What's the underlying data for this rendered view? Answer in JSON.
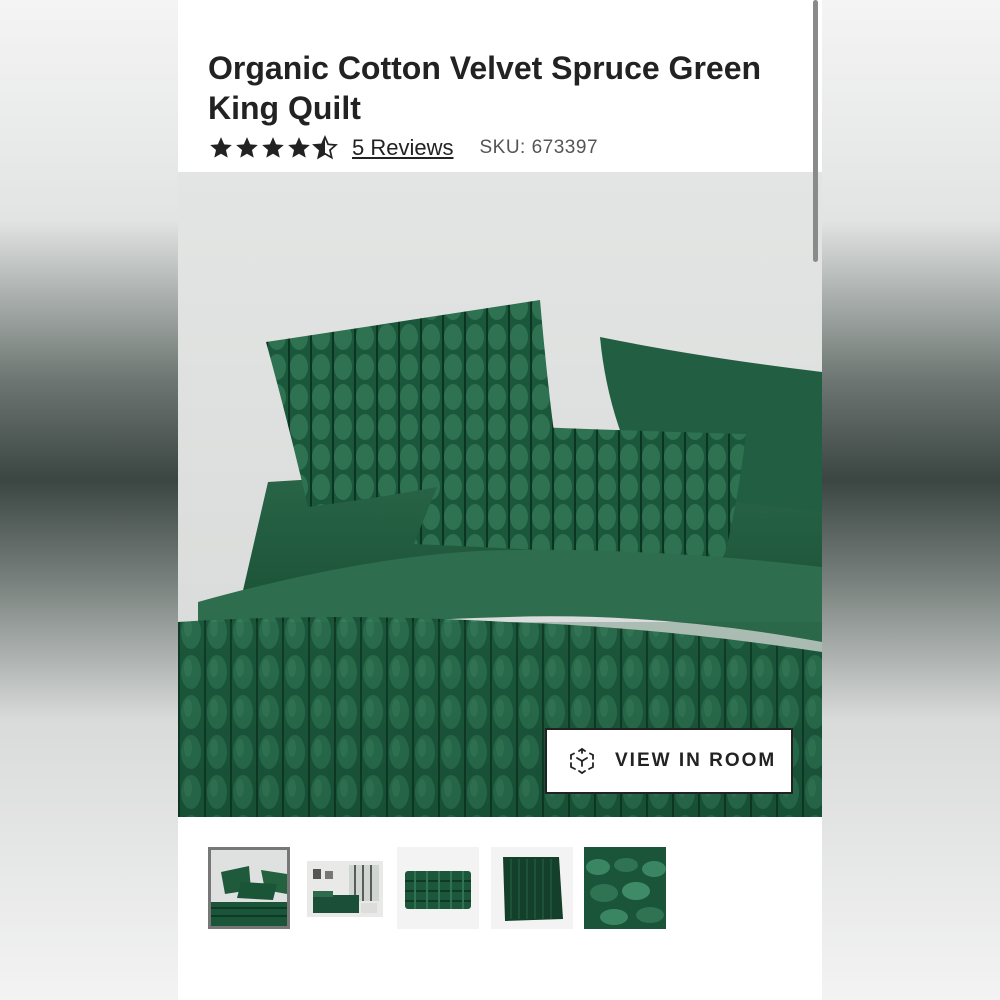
{
  "product": {
    "title": "Organic Cotton Velvet Spruce Green King Quilt",
    "rating": 4.5,
    "rating_max": 5,
    "reviews_label": "5 Reviews",
    "sku_label": "SKU: 673397"
  },
  "hero": {
    "view_in_room_label": "VIEW IN ROOM",
    "view_in_room_icon": "ar-cube-icon"
  },
  "thumbnails": [
    {
      "name": "thumbnail-bed-closeup",
      "selected": true
    },
    {
      "name": "thumbnail-bedroom-scene",
      "selected": false
    },
    {
      "name": "thumbnail-folded-quilt",
      "selected": false
    },
    {
      "name": "thumbnail-flat-quilt",
      "selected": false
    },
    {
      "name": "thumbnail-velvet-texture",
      "selected": false
    }
  ],
  "colors": {
    "spruce_green": "#1f5a3d",
    "text": "#222222",
    "muted": "#555555"
  }
}
